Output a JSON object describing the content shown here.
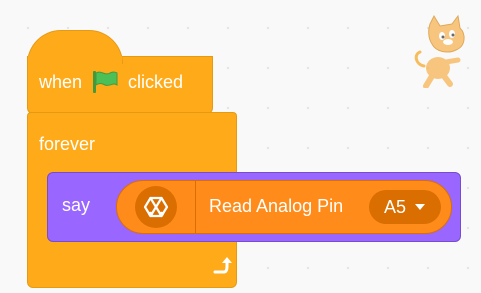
{
  "hat_block": {
    "prefix": "when",
    "icon": "green-flag-icon",
    "suffix": "clicked"
  },
  "forever_block": {
    "label": "forever",
    "icon": "loop-arrow-icon"
  },
  "say_block": {
    "label": "say"
  },
  "reporter_block": {
    "extension_icon": "hexagon-extension-icon",
    "label": "Read Analog Pin",
    "dropdown_value": "A5"
  },
  "sprite": {
    "icon": "scratch-cat-sprite"
  },
  "colors": {
    "events": "#ffab19",
    "control": "#ffab19",
    "looks": "#9966ff",
    "extension": "#ff8c1a",
    "extension_dark": "#db6e00",
    "flag_green": "#4cbf56"
  }
}
